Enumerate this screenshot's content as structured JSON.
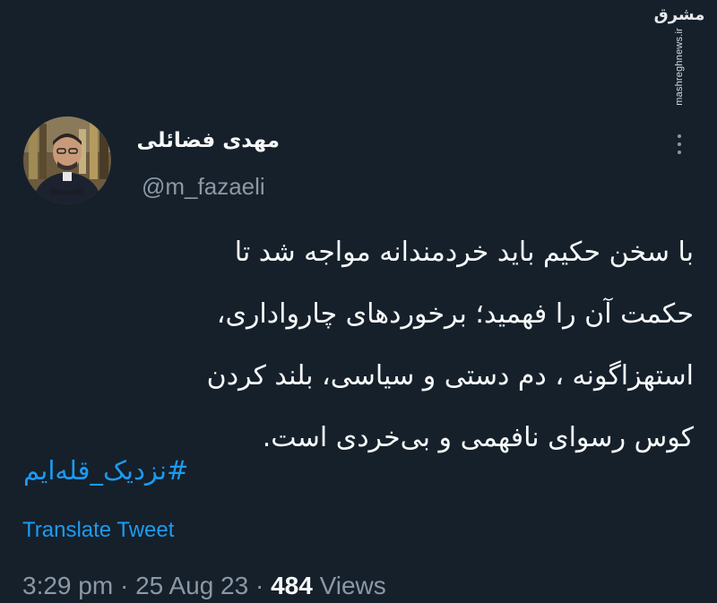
{
  "watermark": {
    "logo": "مشرق",
    "url": "mashreghnews.ir"
  },
  "author": {
    "name": "مهدی فضائلی",
    "handle": "@m_fazaeli"
  },
  "tweet": {
    "lines": [
      "با سخن حکیم باید خردمندانه مواجه شد تا",
      "حکمت آن را فهمید؛ برخوردهای چارواداری،",
      "استهزاگونه ، دم دستی و سیاسی، بلند کردن",
      "کوس رسوای نافهمی و بی‌خردی است."
    ],
    "hashtag": "#نزدیک_قله‌ایم"
  },
  "actions": {
    "translate": "Translate Tweet"
  },
  "meta": {
    "time": "3:29 pm",
    "separator": "·",
    "date": "25 Aug 23",
    "views_count": "484",
    "views_label": "Views"
  },
  "icons": {
    "more": "more-options-icon"
  },
  "colors": {
    "background": "#15202b",
    "text": "#f7f9f9",
    "secondary": "#8b98a5",
    "link": "#1d9bf0"
  }
}
